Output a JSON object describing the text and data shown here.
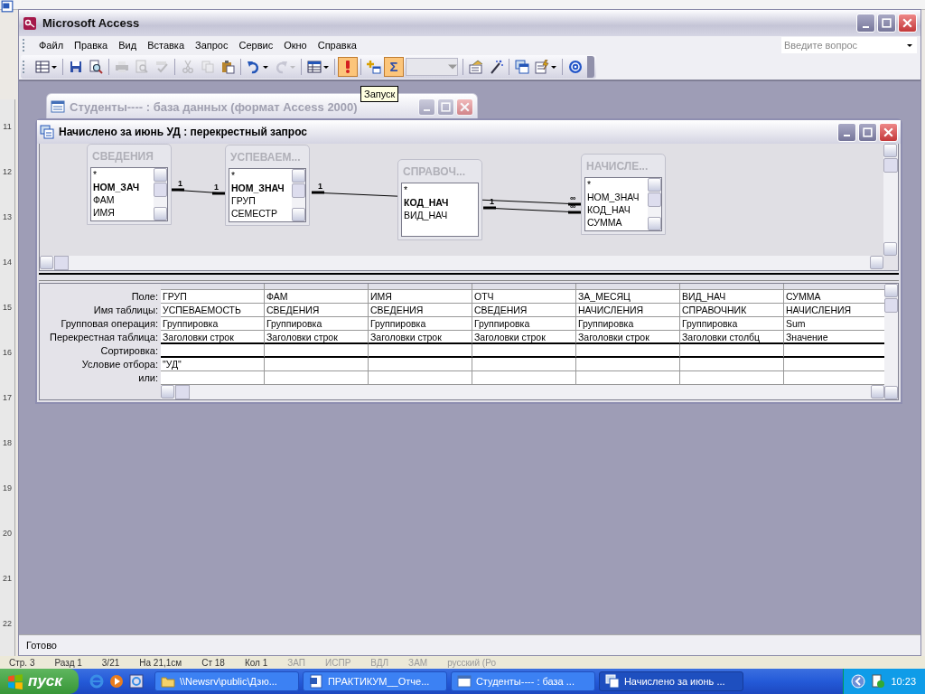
{
  "word_background": {
    "ruler_numbers": [
      "11",
      "12",
      "13",
      "14",
      "15",
      "16",
      "17",
      "18",
      "19",
      "20",
      "21",
      "22"
    ],
    "status_bar": [
      "Стр. 3",
      "Разд 1",
      "3/21",
      "На 21,1см",
      "Ст 18",
      "Кол 1",
      "ЗАП",
      "ИСПР",
      "ВДЛ",
      "ЗАМ",
      "русский (Ро"
    ]
  },
  "window": {
    "title": "Microsoft Access"
  },
  "menu": [
    "Файл",
    "Правка",
    "Вид",
    "Вставка",
    "Запрос",
    "Сервис",
    "Окно",
    "Справка"
  ],
  "help_box": {
    "placeholder": "Введите вопрос"
  },
  "toolbar": [
    [
      {
        "kind": "view",
        "dropdown": true,
        "disabled": false
      }
    ],
    [
      {
        "kind": "save",
        "dropdown": false,
        "disabled": false
      },
      {
        "kind": "file-search",
        "dropdown": false,
        "disabled": false
      }
    ],
    [
      {
        "kind": "print",
        "dropdown": false,
        "disabled": true
      },
      {
        "kind": "preview",
        "dropdown": false,
        "disabled": true
      },
      {
        "kind": "spell",
        "dropdown": false,
        "disabled": true
      }
    ],
    [
      {
        "kind": "cut",
        "dropdown": false,
        "disabled": true
      },
      {
        "kind": "copy",
        "dropdown": false,
        "disabled": true
      },
      {
        "kind": "paste",
        "dropdown": false,
        "disabled": false
      }
    ],
    [
      {
        "kind": "undo",
        "dropdown": true,
        "disabled": false
      },
      {
        "kind": "redo",
        "dropdown": true,
        "disabled": true
      }
    ],
    [
      {
        "kind": "query-type",
        "dropdown": true,
        "disabled": false
      }
    ],
    [
      {
        "kind": "run",
        "dropdown": false,
        "disabled": false,
        "on": true
      }
    ],
    [
      {
        "kind": "show-table",
        "dropdown": false,
        "disabled": false
      },
      {
        "kind": "totals",
        "label": "Σ",
        "dropdown": false,
        "disabled": false,
        "on": true
      },
      {
        "kind": "top-values",
        "dropdown": true,
        "disabled": true
      }
    ],
    [
      {
        "kind": "properties",
        "dropdown": false,
        "disabled": false
      },
      {
        "kind": "builder",
        "dropdown": false,
        "disabled": false
      }
    ],
    [
      {
        "kind": "database-window",
        "dropdown": false,
        "disabled": false
      },
      {
        "kind": "new-object",
        "dropdown": true,
        "disabled": false
      }
    ],
    [
      {
        "kind": "help",
        "dropdown": false,
        "disabled": false
      }
    ]
  ],
  "tooltip": "Запуск",
  "db_window": {
    "title": "Студенты---- : база данных (формат Access 2000)",
    "active": false
  },
  "query_window": {
    "title": "Начислено за июнь УД : перекрестный запрос",
    "active": true
  },
  "tables": [
    {
      "title": "СВЕДЕНИЯ",
      "fields": [
        {
          "name": "*",
          "key": false
        },
        {
          "name": "НОМ_ЗАЧ",
          "key": true
        },
        {
          "name": "ФАМ",
          "key": false
        },
        {
          "name": "ИМЯ",
          "key": false
        }
      ]
    },
    {
      "title": "УСПЕВАЕМ...",
      "fields": [
        {
          "name": "*",
          "key": false
        },
        {
          "name": "НОМ_ЗНАЧ",
          "key": true
        },
        {
          "name": "ГРУП",
          "key": false
        },
        {
          "name": "СЕМЕСТР",
          "key": false
        }
      ]
    },
    {
      "title": "СПРАВОЧ...",
      "fields": [
        {
          "name": "*",
          "key": false
        },
        {
          "name": "КОД_НАЧ",
          "key": true
        },
        {
          "name": "ВИД_НАЧ",
          "key": false
        }
      ]
    },
    {
      "title": "НАЧИСЛЕ...",
      "fields": [
        {
          "name": "*",
          "key": false
        },
        {
          "name": "НОМ_ЗНАЧ",
          "key": false
        },
        {
          "name": "КОД_НАЧ",
          "key": false
        },
        {
          "name": "СУММА",
          "key": false
        }
      ]
    }
  ],
  "relations": [
    {
      "from_mark": "1",
      "to_mark": "1"
    },
    {
      "from_mark": "1",
      "to_mark": "∞"
    },
    {
      "from_mark": "1",
      "to_mark": "∞"
    }
  ],
  "grid": {
    "row_labels": [
      "Поле:",
      "Имя таблицы:",
      "Групповая операция:",
      "Перекрестная таблица:",
      "Сортировка:",
      "Условие отбора:",
      "или:"
    ],
    "columns": [
      {
        "field": "ГРУП",
        "table": "УСПЕВАЕМОСТЬ",
        "total": "Группировка",
        "crosstab": "Заголовки строк",
        "criteria": "\"УД\""
      },
      {
        "field": "ФАМ",
        "table": "СВЕДЕНИЯ",
        "total": "Группировка",
        "crosstab": "Заголовки строк"
      },
      {
        "field": "ИМЯ",
        "table": "СВЕДЕНИЯ",
        "total": "Группировка",
        "crosstab": "Заголовки строк"
      },
      {
        "field": "ОТЧ",
        "table": "СВЕДЕНИЯ",
        "total": "Группировка",
        "crosstab": "Заголовки строк"
      },
      {
        "field": "ЗА_МЕСЯЦ",
        "table": "НАЧИСЛЕНИЯ",
        "total": "Группировка",
        "crosstab": "Заголовки строк"
      },
      {
        "field": "ВИД_НАЧ",
        "table": "СПРАВОЧНИК",
        "total": "Группировка",
        "crosstab": "Заголовки столбц"
      },
      {
        "field": "СУММА",
        "table": "НАЧИСЛЕНИЯ",
        "total": "Sum",
        "crosstab": "Значение"
      }
    ]
  },
  "status_bar": "Готово",
  "taskbar": {
    "start": "пуск",
    "tasks": [
      {
        "label": "\\\\Newsrv\\public\\Дзю...",
        "kind": "folder",
        "selected": false
      },
      {
        "label": "ПРАКТИКУМ__Отче...",
        "kind": "word",
        "selected": false
      },
      {
        "label": "Студенты---- : база ...",
        "kind": "database",
        "selected": false
      },
      {
        "label": "Начислено за июнь ...",
        "kind": "query",
        "selected": true
      }
    ],
    "clock": "10:23"
  }
}
